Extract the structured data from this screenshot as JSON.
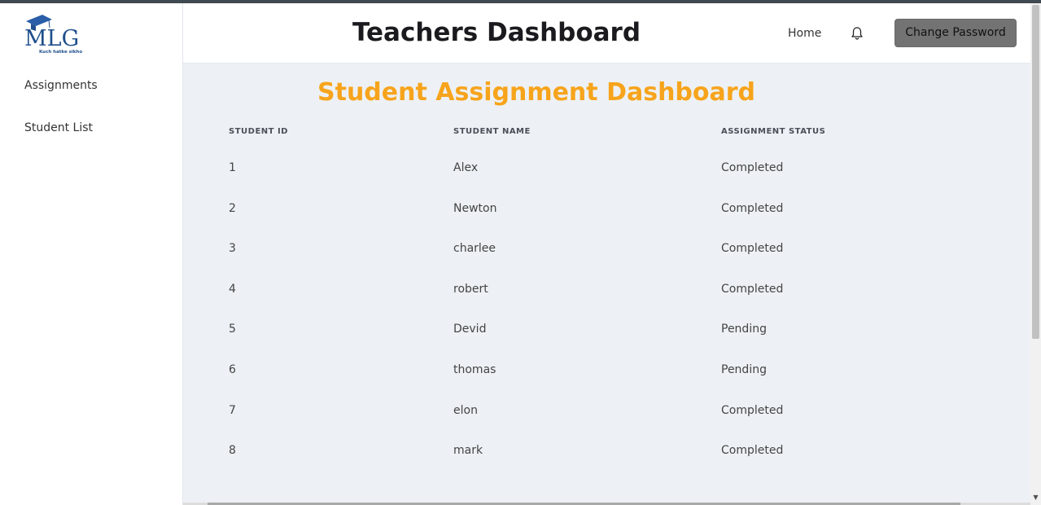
{
  "sidebar": {
    "logo_text": "MLG",
    "logo_tagline": "Kuch hatke sikho",
    "items": [
      {
        "label": "Assignments"
      },
      {
        "label": "Student List"
      }
    ]
  },
  "header": {
    "title": "Teachers Dashboard",
    "home_label": "Home",
    "bell_icon": "bell-icon",
    "change_password_label": "Change Password"
  },
  "main": {
    "title": "Student Assignment Dashboard",
    "columns": [
      "STUDENT ID",
      "STUDENT NAME",
      "ASSIGNMENT STATUS"
    ],
    "rows": [
      {
        "id": "1",
        "name": "Alex",
        "status": "Completed"
      },
      {
        "id": "2",
        "name": "Newton",
        "status": "Completed"
      },
      {
        "id": "3",
        "name": "charlee",
        "status": "Completed"
      },
      {
        "id": "4",
        "name": "robert",
        "status": "Completed"
      },
      {
        "id": "5",
        "name": "Devid",
        "status": "Pending"
      },
      {
        "id": "6",
        "name": "thomas",
        "status": "Pending"
      },
      {
        "id": "7",
        "name": "elon",
        "status": "Completed"
      },
      {
        "id": "8",
        "name": "mark",
        "status": "Completed"
      }
    ]
  },
  "colors": {
    "accent_title": "#f7a41c",
    "main_bg": "#edf1f5",
    "button_bg": "#737373",
    "logo_blue": "#1f4f8c"
  }
}
